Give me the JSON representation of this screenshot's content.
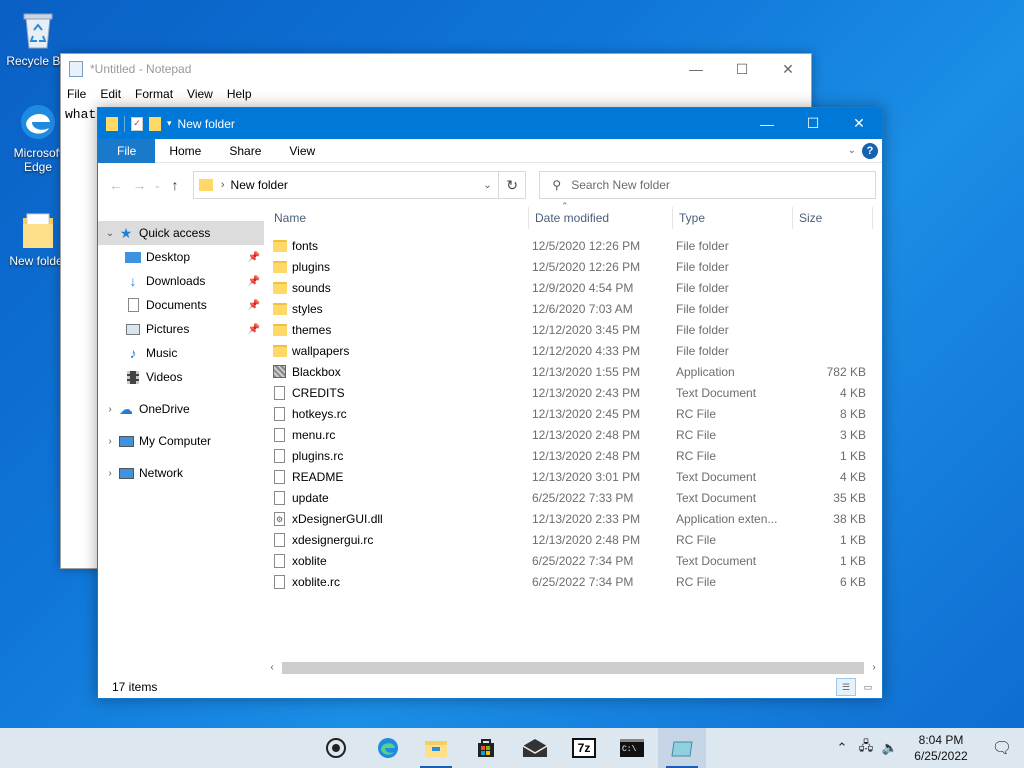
{
  "desktop": {
    "icons": [
      {
        "label": "Recycle Bin",
        "icon": "recycle-bin-icon"
      },
      {
        "label": "Microsoft Edge",
        "icon": "edge-icon"
      },
      {
        "label": "New folder",
        "icon": "folder-icon"
      }
    ]
  },
  "notepad": {
    "title": "*Untitled - Notepad",
    "menu": [
      "File",
      "Edit",
      "Format",
      "View",
      "Help"
    ],
    "text": "what"
  },
  "explorer": {
    "title": "New folder",
    "ribbon_tabs": [
      "File",
      "Home",
      "Share",
      "View"
    ],
    "address": "New folder",
    "search_placeholder": "Search New folder",
    "sidebar": {
      "quick_access": "Quick access",
      "pinned": [
        "Desktop",
        "Downloads",
        "Documents",
        "Pictures"
      ],
      "unpinned": [
        "Music",
        "Videos"
      ],
      "onedrive": "OneDrive",
      "my_computer": "My Computer",
      "network": "Network"
    },
    "columns": {
      "name": "Name",
      "date": "Date modified",
      "type": "Type",
      "size": "Size"
    },
    "files": [
      {
        "name": "fonts",
        "date": "12/5/2020 12:26 PM",
        "type": "File folder",
        "size": "",
        "kind": "folder"
      },
      {
        "name": "plugins",
        "date": "12/5/2020 12:26 PM",
        "type": "File folder",
        "size": "",
        "kind": "folder"
      },
      {
        "name": "sounds",
        "date": "12/9/2020 4:54 PM",
        "type": "File folder",
        "size": "",
        "kind": "folder"
      },
      {
        "name": "styles",
        "date": "12/6/2020 7:03 AM",
        "type": "File folder",
        "size": "",
        "kind": "folder"
      },
      {
        "name": "themes",
        "date": "12/12/2020 3:45 PM",
        "type": "File folder",
        "size": "",
        "kind": "folder"
      },
      {
        "name": "wallpapers",
        "date": "12/12/2020 4:33 PM",
        "type": "File folder",
        "size": "",
        "kind": "folder"
      },
      {
        "name": "Blackbox",
        "date": "12/13/2020 1:55 PM",
        "type": "Application",
        "size": "782 KB",
        "kind": "app"
      },
      {
        "name": "CREDITS",
        "date": "12/13/2020 2:43 PM",
        "type": "Text Document",
        "size": "4 KB",
        "kind": "doc"
      },
      {
        "name": "hotkeys.rc",
        "date": "12/13/2020 2:45 PM",
        "type": "RC File",
        "size": "8 KB",
        "kind": "doc"
      },
      {
        "name": "menu.rc",
        "date": "12/13/2020 2:48 PM",
        "type": "RC File",
        "size": "3 KB",
        "kind": "doc"
      },
      {
        "name": "plugins.rc",
        "date": "12/13/2020 2:48 PM",
        "type": "RC File",
        "size": "1 KB",
        "kind": "doc"
      },
      {
        "name": "README",
        "date": "12/13/2020 3:01 PM",
        "type": "Text Document",
        "size": "4 KB",
        "kind": "doc"
      },
      {
        "name": "update",
        "date": "6/25/2022 7:33 PM",
        "type": "Text Document",
        "size": "35 KB",
        "kind": "doc"
      },
      {
        "name": "xDesignerGUI.dll",
        "date": "12/13/2020 2:33 PM",
        "type": "Application exten...",
        "size": "38 KB",
        "kind": "dll"
      },
      {
        "name": "xdesignergui.rc",
        "date": "12/13/2020 2:48 PM",
        "type": "RC File",
        "size": "1 KB",
        "kind": "doc"
      },
      {
        "name": "xoblite",
        "date": "6/25/2022 7:34 PM",
        "type": "Text Document",
        "size": "1 KB",
        "kind": "doc"
      },
      {
        "name": "xoblite.rc",
        "date": "6/25/2022 7:34 PM",
        "type": "RC File",
        "size": "6 KB",
        "kind": "doc"
      }
    ],
    "status": "17 items"
  },
  "taskbar": {
    "apps": [
      "cortana-icon",
      "edge-icon",
      "file-explorer-icon",
      "store-icon",
      "mail-icon",
      "7zip-icon",
      "cmd-icon",
      "blackbox-icon"
    ],
    "time": "8:04 PM",
    "date": "6/25/2022"
  },
  "colors": {
    "accent": "#0078d7",
    "folder": "#ffd865",
    "selection": "#dcdcdc"
  }
}
